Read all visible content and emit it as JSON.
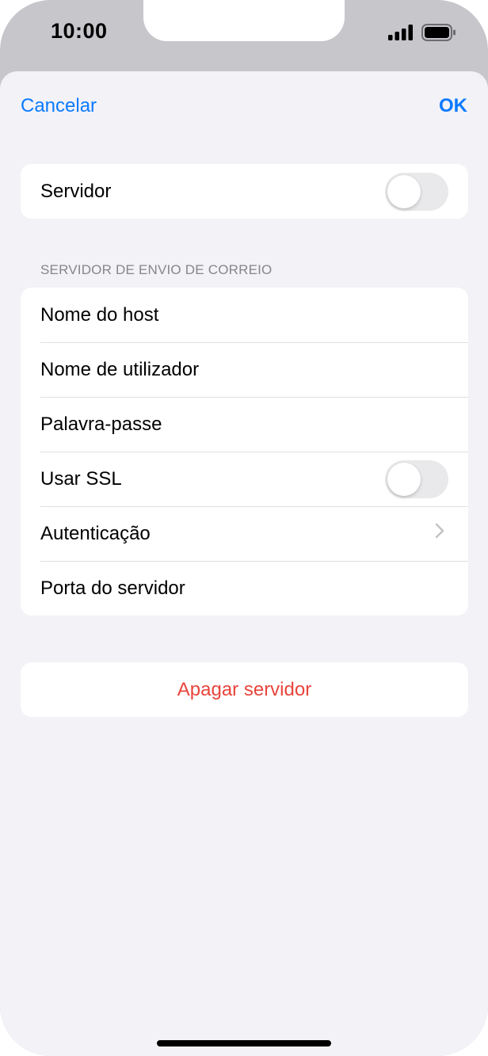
{
  "status_bar": {
    "time": "10:00",
    "icons": [
      "signal-icon",
      "battery-icon"
    ]
  },
  "nav": {
    "cancel_label": "Cancelar",
    "ok_label": "OK"
  },
  "server_group": {
    "label": "Servidor",
    "toggle_on": false
  },
  "outgoing_section": {
    "header": "SERVIDOR DE ENVIO DE CORREIO",
    "rows": [
      {
        "label": "Nome do host",
        "type": "field"
      },
      {
        "label": "Nome de utilizador",
        "type": "field"
      },
      {
        "label": "Palavra-passe",
        "type": "field"
      },
      {
        "label": "Usar SSL",
        "type": "toggle",
        "toggle_on": false
      },
      {
        "label": "Autenticação",
        "type": "disclosure"
      },
      {
        "label": "Porta do servidor",
        "type": "field"
      }
    ]
  },
  "delete_group": {
    "label": "Apagar servidor"
  },
  "colors": {
    "accent": "#0a7aff",
    "destructive": "#e8453c",
    "background": "#f2f2f7",
    "toggle_off": "#e9e9eb"
  }
}
